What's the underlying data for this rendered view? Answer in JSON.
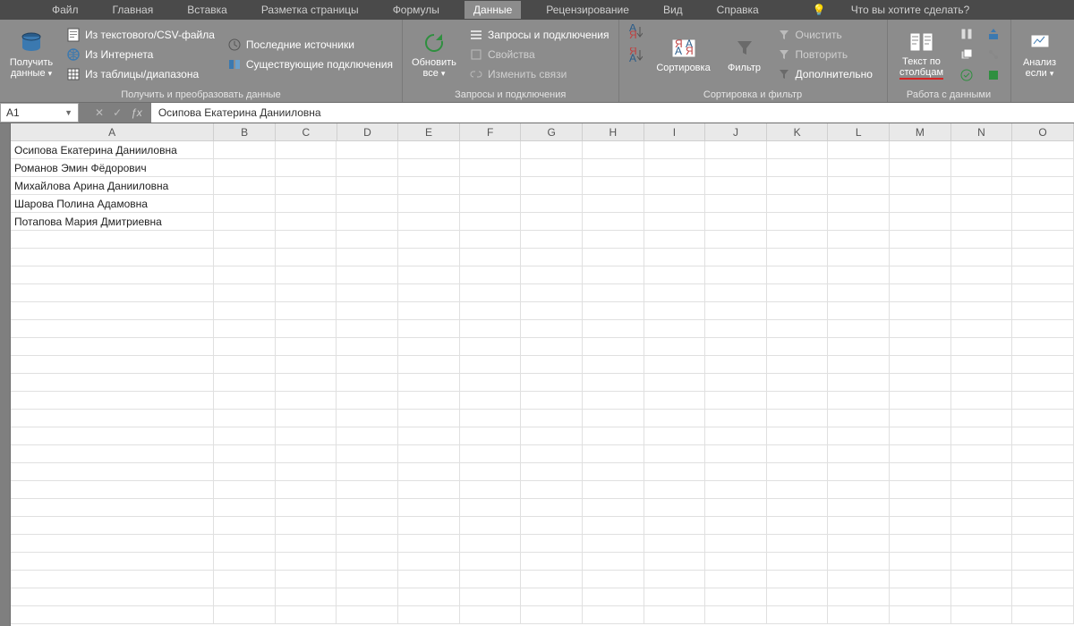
{
  "menu": {
    "tabs": [
      "Файл",
      "Главная",
      "Вставка",
      "Разметка страницы",
      "Формулы",
      "Данные",
      "Рецензирование",
      "Вид",
      "Справка"
    ],
    "active": "Данные",
    "tellme": "Что вы хотите сделать?"
  },
  "ribbon": {
    "g1": {
      "label": "Получить и преобразовать данные",
      "get_data": "Получить\nданные",
      "items": [
        "Из текстового/CSV-файла",
        "Из Интернета",
        "Из таблицы/диапазона",
        "Последние источники",
        "Существующие подключения"
      ]
    },
    "g2": {
      "label": "Запросы и подключения",
      "refresh": "Обновить\nвсе",
      "items": [
        "Запросы и подключения",
        "Свойства",
        "Изменить связи"
      ]
    },
    "g3": {
      "label": "Сортировка и фильтр",
      "sort": "Сортировка",
      "filter": "Фильтр",
      "items": [
        "Очистить",
        "Повторить",
        "Дополнительно"
      ]
    },
    "g4": {
      "label": "Работа с данными",
      "text_to_cols": "Текст по\nстолбцам"
    },
    "g5": {
      "analysis": "Анализ\nесли"
    }
  },
  "namebox": {
    "value": "A1"
  },
  "formula": {
    "value": "Осипова Екатерина Данииловна"
  },
  "columns": [
    "A",
    "B",
    "C",
    "D",
    "E",
    "F",
    "G",
    "H",
    "I",
    "J",
    "K",
    "L",
    "M",
    "N",
    "O"
  ],
  "cells": {
    "A": [
      "Осипова Екатерина Данииловна",
      "Романов Эмин Фёдорович",
      "Михайлова Арина Данииловна",
      "Шарова Полина Адамовна",
      "Потапова Мария Дмитриевна"
    ]
  },
  "row_count": 27
}
